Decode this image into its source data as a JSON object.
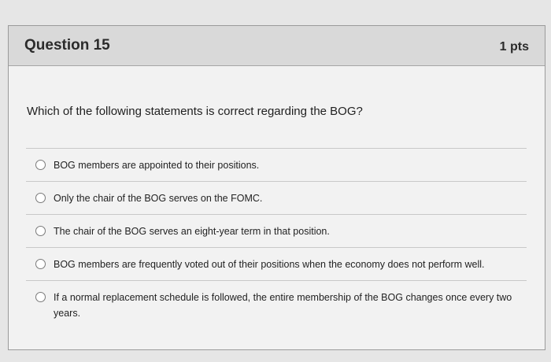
{
  "question": {
    "title": "Question 15",
    "points": "1 pts",
    "prompt": "Which of the following statements is correct regarding the BOG?",
    "options": [
      "BOG members are appointed to their positions.",
      "Only the chair of the BOG serves on the FOMC.",
      "The chair of the BOG serves an eight-year term in that position.",
      "BOG members are frequently voted out of their positions when the economy does not perform well.",
      "If a normal replacement schedule is followed, the entire membership of the BOG changes once every two years."
    ]
  }
}
